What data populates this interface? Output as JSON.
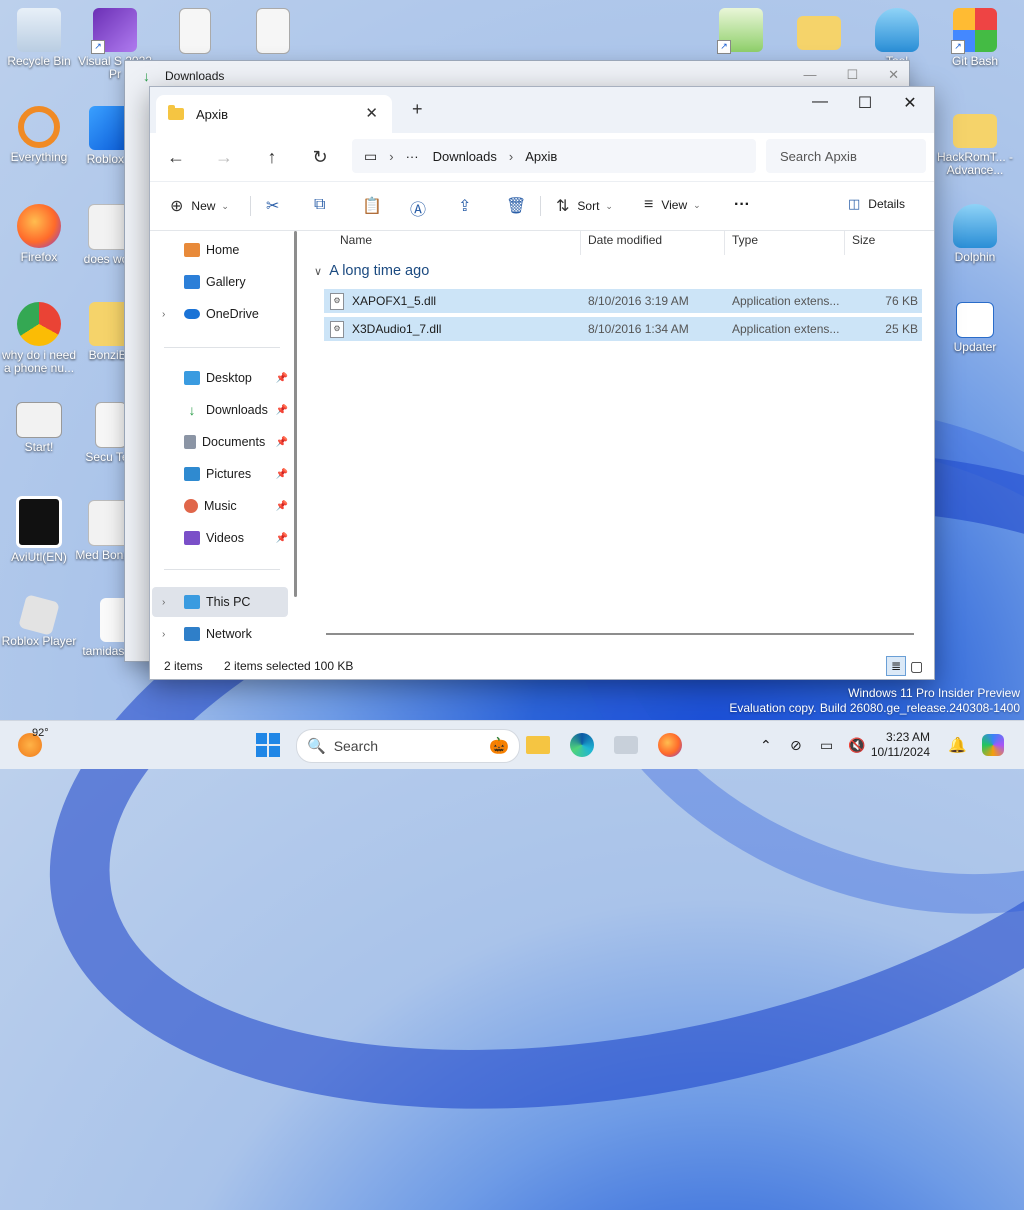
{
  "desktop": {
    "icons": [
      {
        "label": "Recycle Bin"
      },
      {
        "label": "Visual S 2022 Pr"
      },
      {
        "label": ""
      },
      {
        "label": ""
      },
      {
        "label": ""
      },
      {
        "label": ""
      },
      {
        "label": "Tool"
      },
      {
        "label": "Git Bash"
      },
      {
        "label": "Everything"
      },
      {
        "label": "Roblox S"
      },
      {
        "label": "HackRomT... - Advance..."
      },
      {
        "label": "Firefox"
      },
      {
        "label": "does work"
      },
      {
        "label": "Dolphin"
      },
      {
        "label": "why do i need a phone nu..."
      },
      {
        "label": "BonziBu"
      },
      {
        "label": "Updater"
      },
      {
        "label": "Start!"
      },
      {
        "label": "Secu Terr"
      },
      {
        "label": "AviUtl(EN)"
      },
      {
        "label": "Med BonziBu"
      },
      {
        "label": "Roblox Player"
      },
      {
        "label": "tamidasn.ne"
      }
    ]
  },
  "back_window": {
    "title": "Downloads"
  },
  "window": {
    "tab_title": "Архів",
    "address": {
      "crumb_more": "···",
      "crumb1": "Downloads",
      "crumb2": "Архів",
      "search_placeholder": "Search Архів"
    },
    "toolbar": {
      "new_label": "New",
      "sort_label": "Sort",
      "view_label": "View",
      "more_label": "···",
      "details_label": "Details"
    },
    "sidebar": {
      "home": "Home",
      "gallery": "Gallery",
      "onedrive": "OneDrive",
      "desktop": "Desktop",
      "downloads": "Downloads",
      "documents": "Documents",
      "pictures": "Pictures",
      "music": "Music",
      "videos": "Videos",
      "this_pc": "This PC",
      "network": "Network"
    },
    "columns": {
      "name": "Name",
      "date": "Date modified",
      "type": "Type",
      "size": "Size"
    },
    "group_label": "A long time ago",
    "files": [
      {
        "name": "XAPOFX1_5.dll",
        "date": "8/10/2016 3:19 AM",
        "type": "Application extens...",
        "size": "76 KB"
      },
      {
        "name": "X3DAudio1_7.dll",
        "date": "8/10/2016 1:34 AM",
        "type": "Application extens...",
        "size": "25 KB"
      }
    ],
    "status": {
      "count": "2 items",
      "selected": "2 items selected",
      "size": "100 KB"
    }
  },
  "watermark": {
    "line1": "Windows 11 Pro Insider Preview",
    "line2": "Evaluation copy. Build 26080.ge_release.240308-1400"
  },
  "taskbar": {
    "weather_temp": "92°",
    "search_label": "Search",
    "time": "3:23 AM",
    "date": "10/11/2024"
  },
  "colors": {
    "accent": "#0067c0",
    "selection": "#cce4f7",
    "folder": "#f5c542"
  }
}
